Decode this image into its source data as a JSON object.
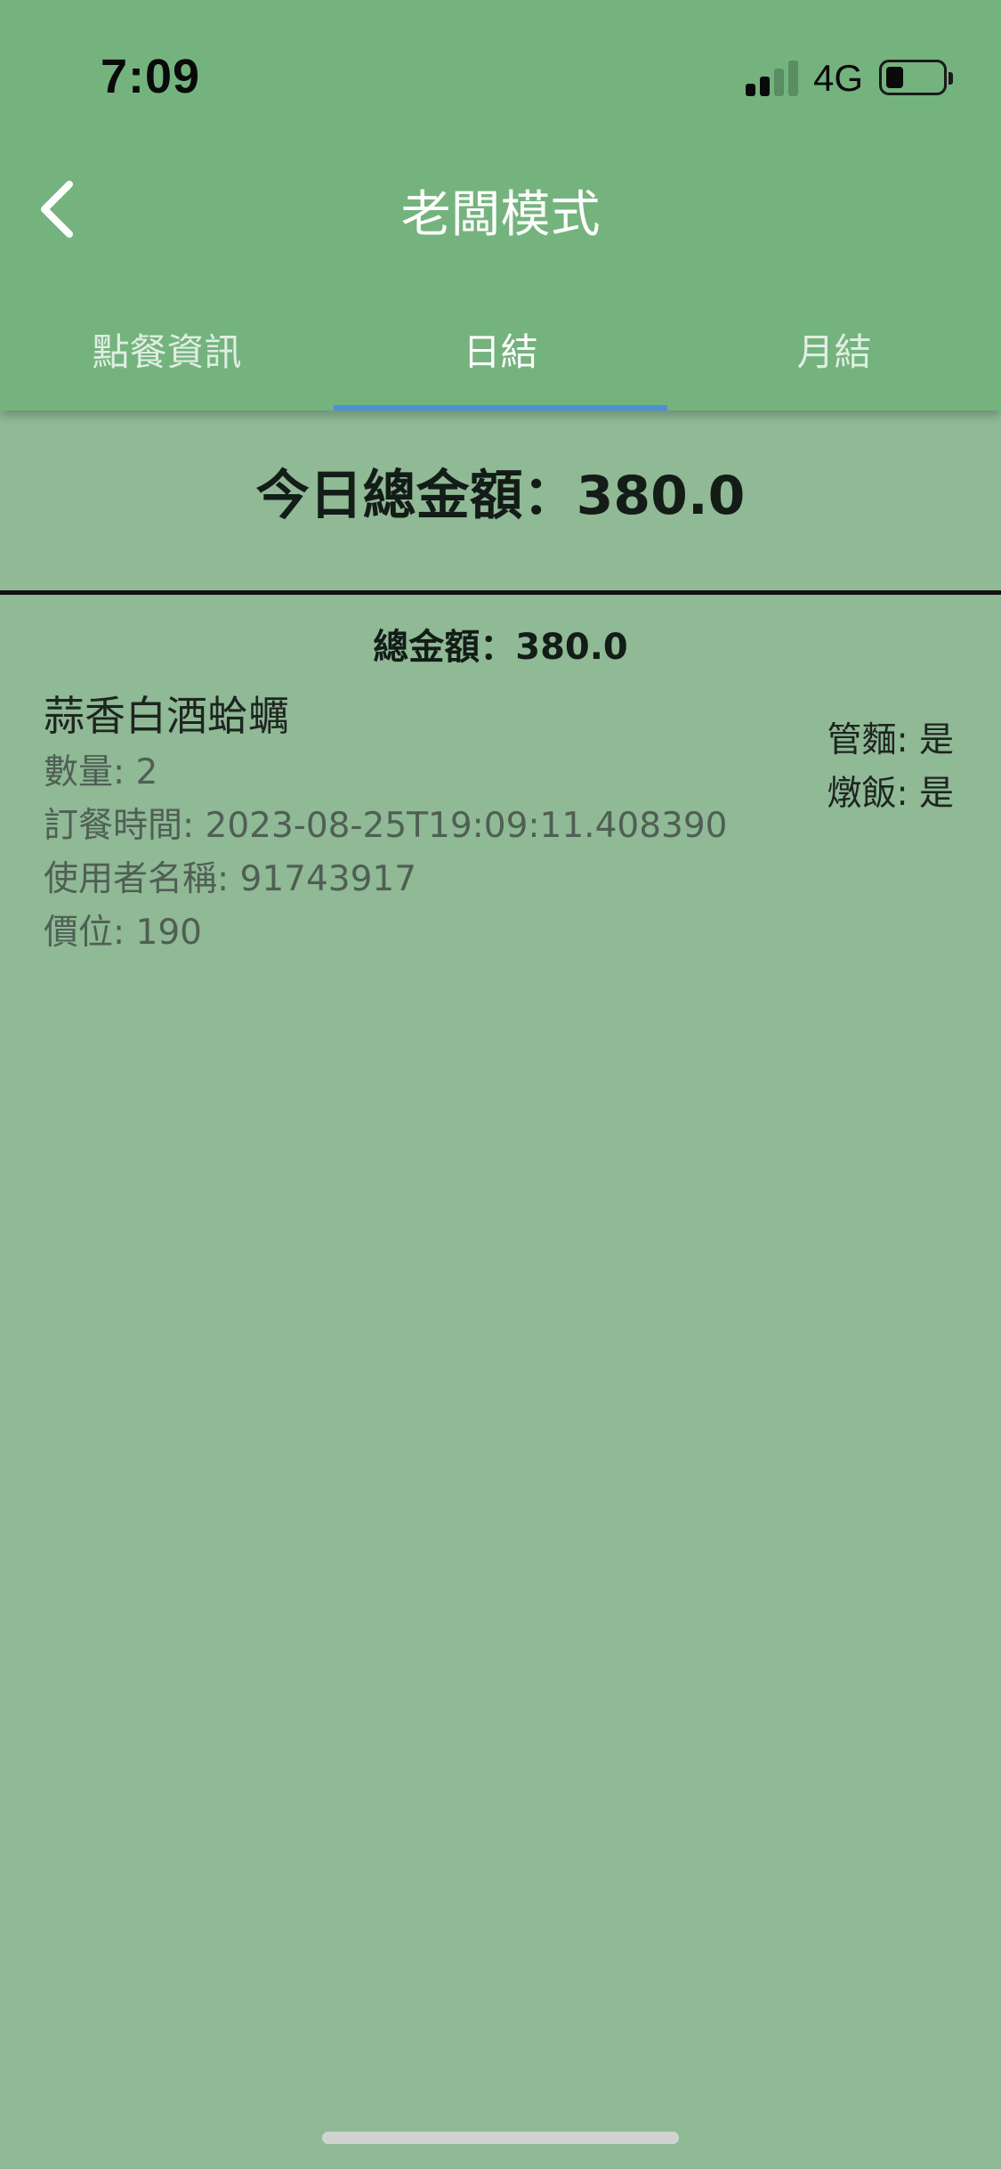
{
  "status_bar": {
    "time": "7:09",
    "network": "4G",
    "signal_bars_active": 2,
    "signal_bars_total": 4,
    "battery_level": 0.3
  },
  "header": {
    "title": "老闆模式",
    "back_icon": "chevron-left-icon"
  },
  "tabs": [
    {
      "label": "點餐資訊",
      "active": false
    },
    {
      "label": "日結",
      "active": true
    },
    {
      "label": "月結",
      "active": false
    }
  ],
  "summary": {
    "today_total": "今日總金額：380.0"
  },
  "orders": {
    "group_total": "總金額：380.0",
    "items": [
      {
        "name": "蒜香白酒蛤蠣",
        "quantity": "數量: 2",
        "order_time": "訂餐時間: 2023-08-25T19:09:11.408390",
        "username": "使用者名稱: 91743917",
        "price": "價位: 190",
        "option_noodle": "管麵: 是",
        "option_rice": "燉飯: 是"
      }
    ]
  },
  "colors": {
    "appbar": "#74b37d",
    "background": "#90b996",
    "tab_indicator": "#4a90d9",
    "title_text": "#ffffff"
  }
}
